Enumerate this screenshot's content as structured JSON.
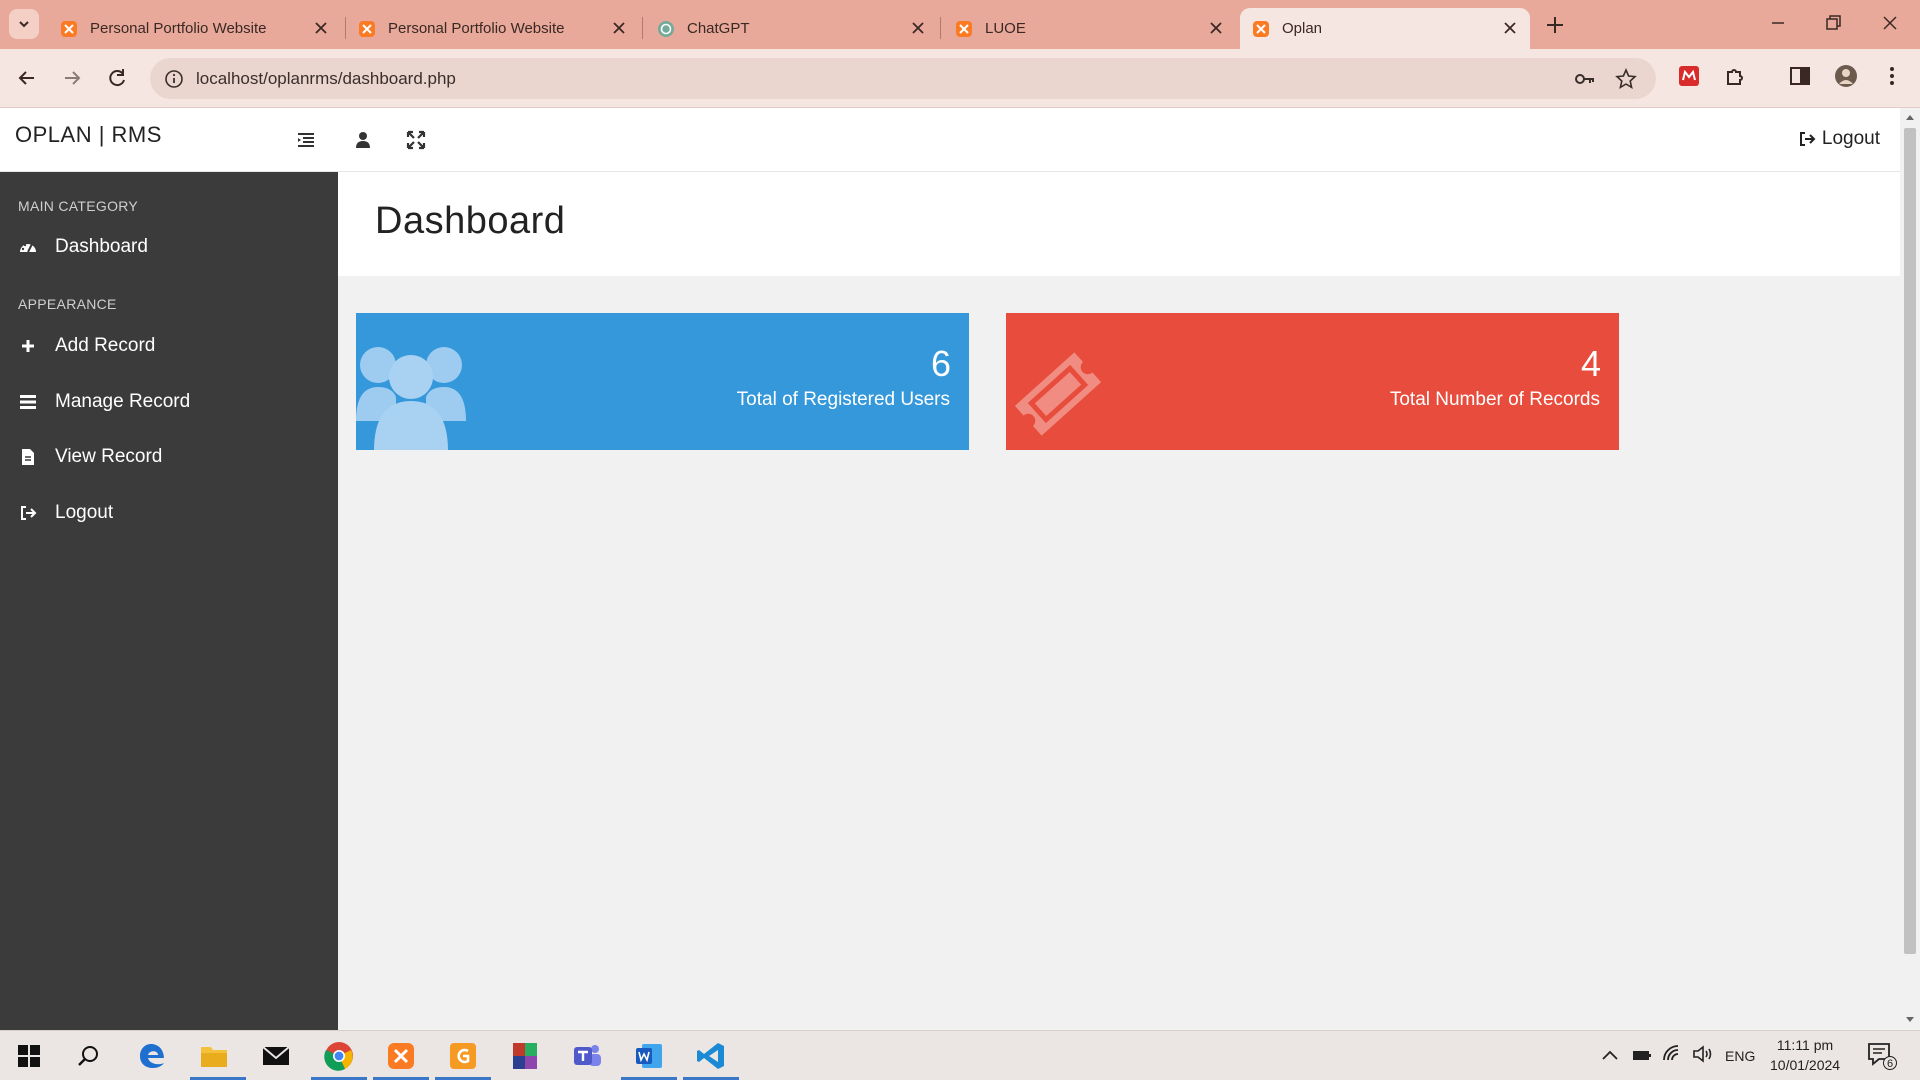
{
  "browser": {
    "tabs": [
      {
        "title": "Personal Portfolio Website",
        "favicon": "xampp-icon",
        "active": false
      },
      {
        "title": "Personal Portfolio Website",
        "favicon": "xampp-icon",
        "active": false
      },
      {
        "title": "ChatGPT",
        "favicon": "chatgpt-icon",
        "active": false
      },
      {
        "title": "LUOE",
        "favicon": "xampp-icon",
        "active": false
      },
      {
        "title": "Oplan",
        "favicon": "xampp-icon",
        "active": true
      }
    ],
    "url": "localhost/oplanrms/dashboard.php",
    "colors": {
      "tabbar": "#e8a99a",
      "toolbar": "#f6e6e1"
    }
  },
  "header": {
    "brand": "OPLAN | RMS",
    "logout_label": "Logout"
  },
  "sidebar": {
    "sections": [
      {
        "heading": "MAIN CATEGORY",
        "items": [
          {
            "label": "Dashboard",
            "icon": "dashboard-icon"
          }
        ]
      },
      {
        "heading": "APPEARANCE",
        "items": [
          {
            "label": "Add Record",
            "icon": "plus-icon"
          },
          {
            "label": "Manage Record",
            "icon": "list-icon"
          },
          {
            "label": "View Record",
            "icon": "file-icon"
          },
          {
            "label": "Logout",
            "icon": "logout-icon"
          }
        ]
      }
    ]
  },
  "main": {
    "page_title": "Dashboard",
    "cards": [
      {
        "value": "6",
        "label": "Total of Registered Users",
        "color": "#3498db",
        "icon": "users-icon"
      },
      {
        "value": "4",
        "label": "Total Number of Records",
        "color": "#e74c3c",
        "icon": "ticket-icon"
      }
    ]
  },
  "taskbar": {
    "language": "ENG",
    "time": "11:11 pm",
    "date": "10/01/2024",
    "notification_count": "6"
  }
}
